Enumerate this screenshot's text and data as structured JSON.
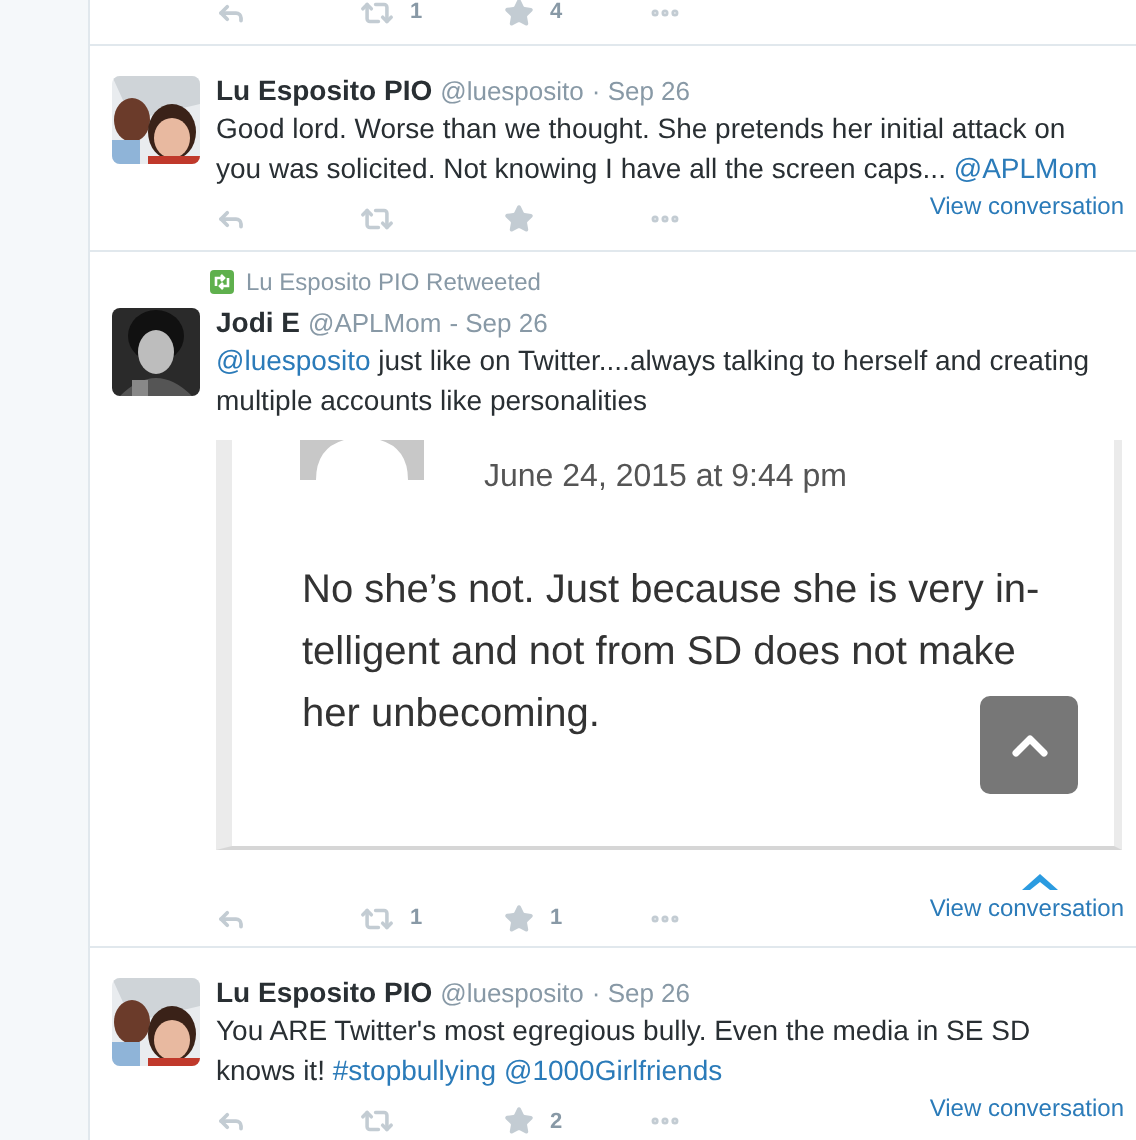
{
  "top_partial": {
    "retweets": "1",
    "favorites": "4"
  },
  "tweets": [
    {
      "name": "Lu Esposito PIO",
      "handle": "@luesposito",
      "time": "· Sep 26",
      "text": [
        {
          "kind": "plain",
          "text": "Good lord. Worse than we thought. She pretends her initial attack on you was solicited. Not knowing I have all the screen caps..."
        },
        {
          "kind": "link",
          "text": "@APLMom"
        }
      ],
      "link": "View conversation"
    },
    {
      "retweeted_by": "Lu Esposito PIO Retweeted",
      "name": "Jodi E",
      "handle": "@APLMom",
      "time": "- Sep 26",
      "text": [
        {
          "kind": "link",
          "text": "@luesposito"
        },
        {
          "kind": "plain",
          "text": "just like on Twitter....always talking to herself and creating multiple accounts like personalities"
        }
      ],
      "media": {
        "kind": "document",
        "date": "June 24, 2015 at 9:44 pm",
        "lines": [
          "No she’s not. Just because she is very in-",
          "telligent and not from SD does not make",
          "her unbecoming."
        ]
      },
      "retweets": "1",
      "favorites": "1",
      "link": "View conversation"
    },
    {
      "name": "Lu Esposito PIO",
      "handle": "@luesposito",
      "time": "· Sep 26",
      "text": [
        {
          "kind": "plain",
          "text": "You ARE Twitter's most egregious bully. Even the media in SE SD knows it!"
        },
        {
          "kind": "link",
          "text": "#stopbullying"
        },
        {
          "kind": "link",
          "text": "@1000Girlfriends"
        }
      ],
      "favorites": "2",
      "link": "View conversation"
    }
  ]
}
